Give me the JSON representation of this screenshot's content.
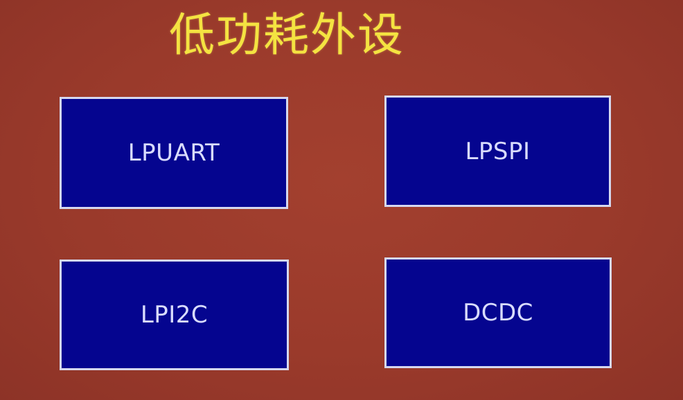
{
  "slide": {
    "title": "低功耗外设",
    "title_color": "#f4e341",
    "background_color": "#9a3a2b",
    "box_color": "#05058f",
    "box_border_color": "#d6d8ef",
    "box_text_color": "#d9dcff",
    "boxes": [
      {
        "label": "LPUART"
      },
      {
        "label": "LPSPI"
      },
      {
        "label": "LPI2C"
      },
      {
        "label": "DCDC"
      }
    ]
  }
}
